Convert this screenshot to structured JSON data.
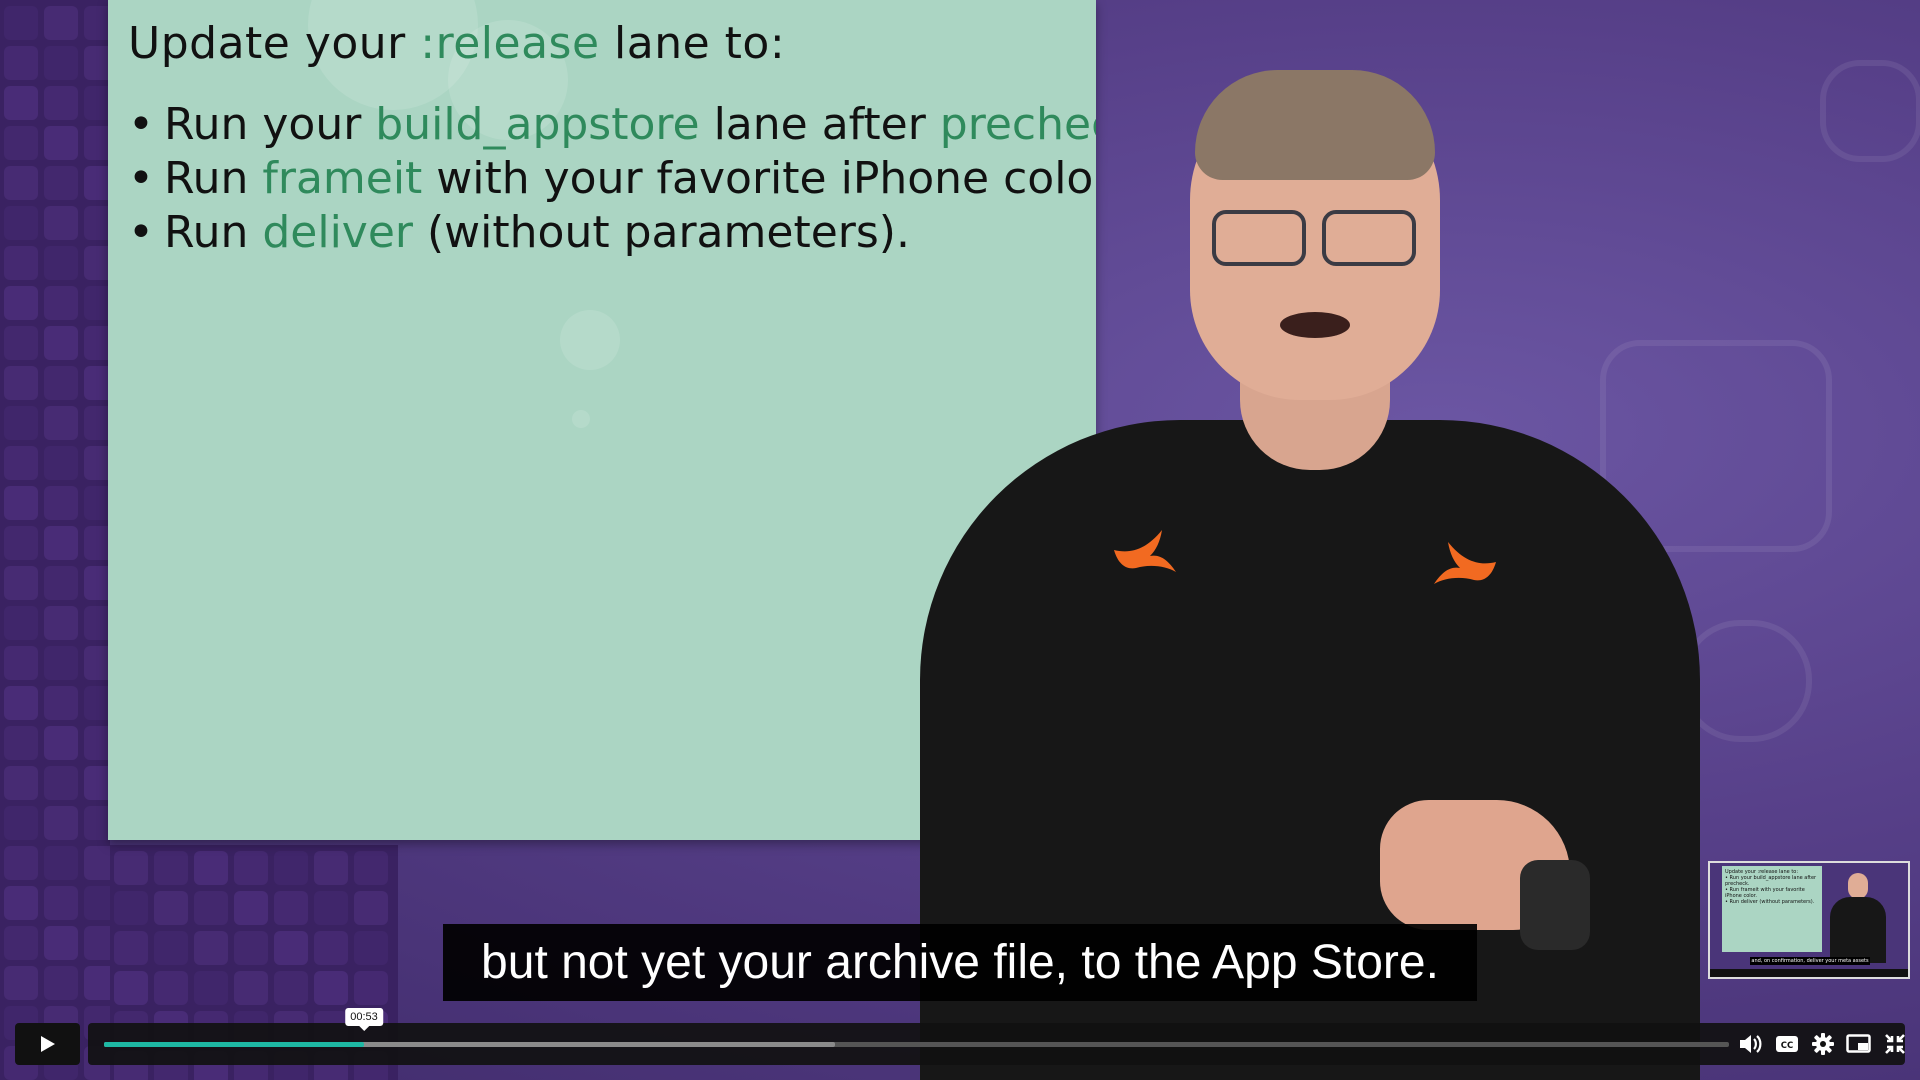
{
  "slide": {
    "title_parts": [
      "Update your ",
      ":release",
      " lane to:"
    ],
    "bullets": [
      [
        "Run your ",
        "build_appstore",
        " lane after ",
        "precheck",
        "."
      ],
      [
        "Run ",
        "frameit",
        " with your favorite iPhone color."
      ],
      [
        "Run ",
        "deliver",
        " (without parameters)."
      ]
    ]
  },
  "caption": {
    "text": "but not yet your archive file, to the App Store."
  },
  "player": {
    "time_tooltip": "00:53",
    "progress_played": 0.16,
    "progress_buffered": 0.45,
    "accent_color": "#1eb8a4"
  },
  "preview": {
    "title": "Update your :release lane to:",
    "lines": [
      "• Run your build_appstore lane after precheck.",
      "• Run frameit with your favorite iPhone color.",
      "• Run deliver (without parameters)."
    ],
    "caption": "and, on confirmation, deliver your meta assets"
  },
  "icons": {
    "play": "play-icon",
    "volume": "volume-icon",
    "cc": "closed-captions-icon",
    "settings": "gear-icon",
    "pip": "picture-in-picture-icon",
    "fullscreen": "exit-fullscreen-icon"
  },
  "colors": {
    "slide_bg": "#abd5c3",
    "code_green": "#2f8a5c",
    "background_purple": "#574089"
  }
}
